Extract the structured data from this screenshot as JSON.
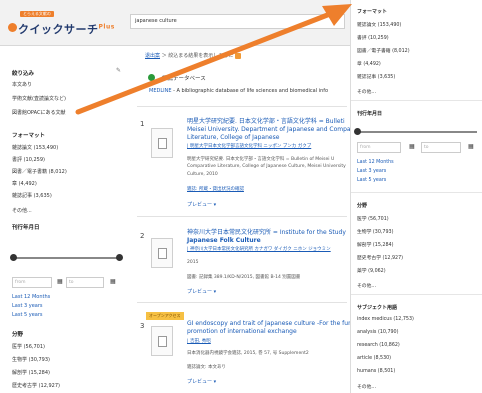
{
  "header": {
    "logo_small": "とらえる文献の",
    "logo_main": "クイックサーチ",
    "logo_plus": "Plus",
    "search_value": "japanese culture"
  },
  "sidebar": {
    "narrow_title": "絞り込み",
    "narrow_items": [
      "本文あり",
      "学術文献(査読論文など)",
      "図書館OPACにある文献"
    ],
    "format_title": "フォーマット",
    "format_items": [
      "雑誌論文 (153,490)",
      "書評 (10,259)",
      "図書／電子書籍 (8,012)",
      "章 (4,492)",
      "雑誌記事 (3,635)",
      "その他..."
    ],
    "date_title": "刊行年月日",
    "date_from_placeholder": "from",
    "date_to_placeholder": "to",
    "date_links": [
      "Last 12 Months",
      "Last 3 years",
      "Last 5 years"
    ],
    "subject_title": "分野",
    "subject_items": [
      "医学 (56,701)",
      "生物学 (30,793)",
      "解剖学 (15,284)",
      "歴史考古学 (12,927)"
    ]
  },
  "main": {
    "crumb_link": "退出案",
    "crumb_text": "＞ 絞込まる結果を表示しました",
    "db_title": "推薦データベース",
    "db_name": "MEDLINE",
    "db_desc": " - A bibliographic database of life sciences and biomedical info",
    "results": [
      {
        "num": "1",
        "title1": "明星大学研究紀要. 日本文化学部・言語文化学科 = Bulleti",
        "title2": "Meisei University. Department of Japanese and Compa",
        "title3": "Literature, College of Japanese",
        "sub": "| 明星大学日本文化学部言語文化学科 ニッポン ブンカ ガクブ",
        "meta1": "明星大学研究紀要. 日本文化学部・言語文化学科 = Bulletin of Meisei U",
        "meta2": "Comparative Literature, College of Japanese Culture, Meisei University",
        "meta3": "Culture, 2010",
        "meta4": "雑誌: 所蔵・貸出状況の確認",
        "preview": "プレビュー ▾"
      },
      {
        "num": "2",
        "title1": "神奈川大学日本常民文化研究所 = Institute for the Study",
        "title2": "Japanese Folk Culture",
        "sub": "| 神奈川大学日本常民文化研究所 カナガワ ダイガク ニホン ジョウミン",
        "meta1": "2015",
        "meta2": "図書: 記録集 389.1/KD-N/2015, 図書館 B-14 別置図書",
        "preview": "プレビュー ▾"
      },
      {
        "num": "3",
        "badge": "オープンアクセス",
        "title1": "GI endoscopy and trait of Japanese culture -For the fur",
        "title2": "promotion of international exchange",
        "sub": "| 吉田, 秀昭",
        "meta1": "日本消化器内視鏡学会雑誌, 2015, 巻 57, 号 Supplement2",
        "meta2": "雑誌論文: 本文あり",
        "preview": "プレビュー ▾"
      }
    ]
  },
  "rpanel": {
    "format_title": "フォーマット",
    "format_items": [
      "雑誌論文 (153,490)",
      "書評 (10,259)",
      "図書／電子書籍 (8,012)",
      "章 (4,492)",
      "雑誌記事 (3,635)",
      "その他..."
    ],
    "date_title": "刊行年月日",
    "date_from_placeholder": "from",
    "date_to_placeholder": "to",
    "date_links": [
      "Last 12 Months",
      "Last 3 years",
      "Last 5 years"
    ],
    "subject_title": "分野",
    "subject_items": [
      "医学 (56,701)",
      "生物学 (30,793)",
      "解剖学 (15,284)",
      "歴史考古学 (12,927)",
      "薬学 (9,062)",
      "その他..."
    ],
    "subject2_title": "サブジェクト用語",
    "subject2_items": [
      "index medicus (12,753)",
      "analysis (10,790)",
      "research (10,862)",
      "article (8,530)",
      "humans (8,501)",
      "その他..."
    ]
  },
  "colors": {
    "accent": "#ee7f2c",
    "link": "#1a5bb6",
    "brand": "#223a6e"
  }
}
